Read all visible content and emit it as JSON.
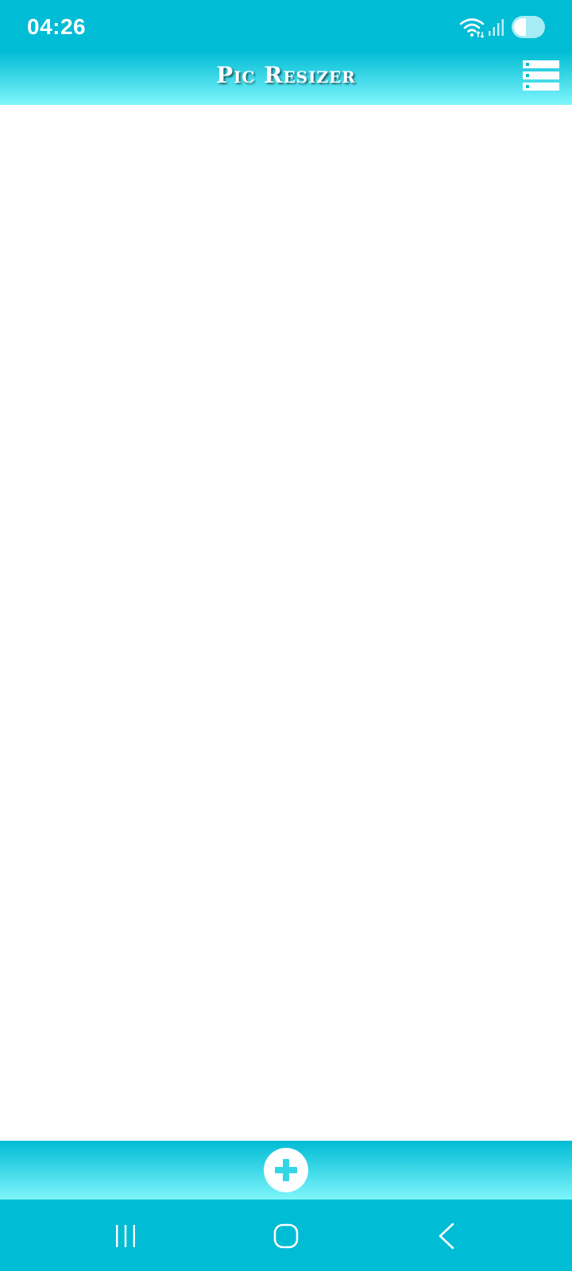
{
  "status_bar": {
    "time": "04:26",
    "icons": [
      "wifi-icon",
      "signal-icon",
      "battery-icon"
    ]
  },
  "header": {
    "title": "Pic Resizer",
    "menu_icon": "list-menu-icon"
  },
  "bottom_bar": {
    "add_icon": "plus-icon"
  },
  "nav_bar": {
    "buttons": [
      "recents-icon",
      "home-icon",
      "back-icon"
    ]
  },
  "colors": {
    "primary": "#00bcd4",
    "gradient_light": "#7ff6fb",
    "background": "#ffffff",
    "icon_white": "#ffffff",
    "accent_icon": "#33d6e6"
  }
}
